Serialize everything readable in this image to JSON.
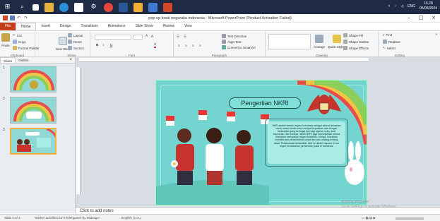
{
  "window": {
    "title": "pop up book negaraku indonesia  -  Microsoft PowerPoint (Product Activation Failed)"
  },
  "taskbar": {
    "apps": [
      "start-icon",
      "search-icon",
      "taskview-icon",
      "file-explorer-icon",
      "edge-icon",
      "mail-icon",
      "settings-icon",
      "chrome-icon",
      "word-icon",
      "files-icon",
      "store-icon",
      "powerpoint-icon"
    ],
    "tray": {
      "lang": "ENG",
      "time": "16.28",
      "date": "05/08/2024"
    }
  },
  "menu": {
    "tabs": [
      "File",
      "Home",
      "Insert",
      "Design",
      "Transitions",
      "Animations",
      "Slide Show",
      "Review",
      "View"
    ]
  },
  "ribbon": {
    "clipboard": {
      "paste": "Paste",
      "cut": "Cut",
      "copy": "Copy",
      "format_painter": "Format Painter",
      "label": "Clipboard"
    },
    "slides": {
      "new_slide": "New Slide",
      "layout": "Layout",
      "reset": "Reset",
      "section": "Section",
      "label": "Slides"
    },
    "font": {
      "label": "Font",
      "bold": "B",
      "italic": "I",
      "underline": "U"
    },
    "paragraph": {
      "text_direction": "Text Direction",
      "align_text": "Align Text",
      "convert_smartart": "Convert to SmartArt",
      "label": "Paragraph"
    },
    "drawing": {
      "arrange": "Arrange",
      "quick_styles": "Quick Styles",
      "shape_fill": "Shape Fill",
      "shape_outline": "Shape Outline",
      "shape_effects": "Shape Effects",
      "label": "Drawing"
    },
    "editing": {
      "find": "Find",
      "replace": "Replace",
      "select": "Select",
      "label": "Editing"
    }
  },
  "panel": {
    "tabs": [
      "Slides",
      "Outline"
    ],
    "close": "×",
    "thumbs": [
      "1",
      "2",
      "3"
    ]
  },
  "slide": {
    "title": "Pengertian NKRI",
    "body": "NKRI adalah bentuk negara Indonesia sebagai sebuah kesatuan untuk means terdiri untuk menjadi kepulauan luas dengan kedaulatan yang berbagai dari bagi agama, suku, adat kepulauan, dan budaya. Istilah NKRI juga menunjukkan bahwa Indonesia merupakan negara kesatuan, Artinya, Indonesia memiliki satu pemerintahan pusat dan satu undang-undang dasar. Pelaksanaan kedaulatan baik itu dalam maupun di luar negeri berdasarkan pemerintah pusat di Indonesia."
  },
  "notes": {
    "placeholder": "Click to add notes"
  },
  "activation": {
    "line1": "Activate Windows",
    "line2": "Go to Settings to activate Windows."
  },
  "status": {
    "slide": "Slide 3 of 3",
    "theme": "\"Sticker activities for Kindergarten by Slidesgo\"",
    "language": "English (U.S.)"
  }
}
